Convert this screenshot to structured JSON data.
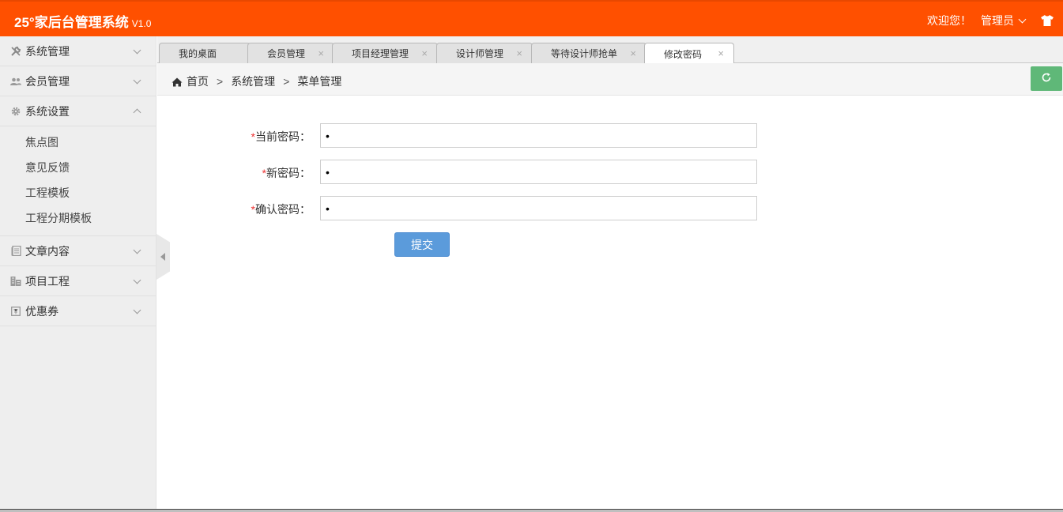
{
  "header": {
    "logo": "25°家后台管理系统",
    "version": "V1.0",
    "welcome": "欢迎您！",
    "user": "管理员",
    "user_menu_icon": "chevron-down-icon",
    "skin_icon": "tshirt-icon",
    "color": "#ff5000"
  },
  "sidebar": {
    "items": [
      {
        "label": "系统管理",
        "icon": "wrench-icon",
        "expanded": false
      },
      {
        "label": "会员管理",
        "icon": "users-icon",
        "expanded": false
      },
      {
        "label": "系统设置",
        "icon": "gear-icon",
        "expanded": true,
        "children": [
          "焦点图",
          "意见反馈",
          "工程模板",
          "工程分期模板"
        ]
      },
      {
        "label": "文章内容",
        "icon": "document-icon",
        "expanded": false
      },
      {
        "label": "项目工程",
        "icon": "building-icon",
        "expanded": false
      },
      {
        "label": "优惠券",
        "icon": "coupon-icon",
        "expanded": false
      }
    ]
  },
  "tabs": [
    {
      "label": "我的桌面",
      "closable": false,
      "active": false
    },
    {
      "label": "会员管理",
      "closable": true,
      "active": false
    },
    {
      "label": "项目经理管理",
      "closable": true,
      "active": false
    },
    {
      "label": "设计师管理",
      "closable": true,
      "active": false
    },
    {
      "label": "等待设计师抢单",
      "closable": true,
      "active": false
    },
    {
      "label": "修改密码",
      "closable": true,
      "active": true
    }
  ],
  "tab_close_glyph": "×",
  "breadcrumb": {
    "home": "首页",
    "sep": ">",
    "level1": "系统管理",
    "level2": "菜单管理"
  },
  "form": {
    "required_mark": "*",
    "fields": [
      {
        "label": "当前密码：",
        "value": "•"
      },
      {
        "label": "新密码：",
        "value": "•"
      },
      {
        "label": "确认密码：",
        "value": "•"
      }
    ],
    "submit": "提交"
  },
  "colors": {
    "accent": "#ff5000",
    "refresh": "#5fb878",
    "submit": "#5b9bdb",
    "required": "#ee3333"
  }
}
